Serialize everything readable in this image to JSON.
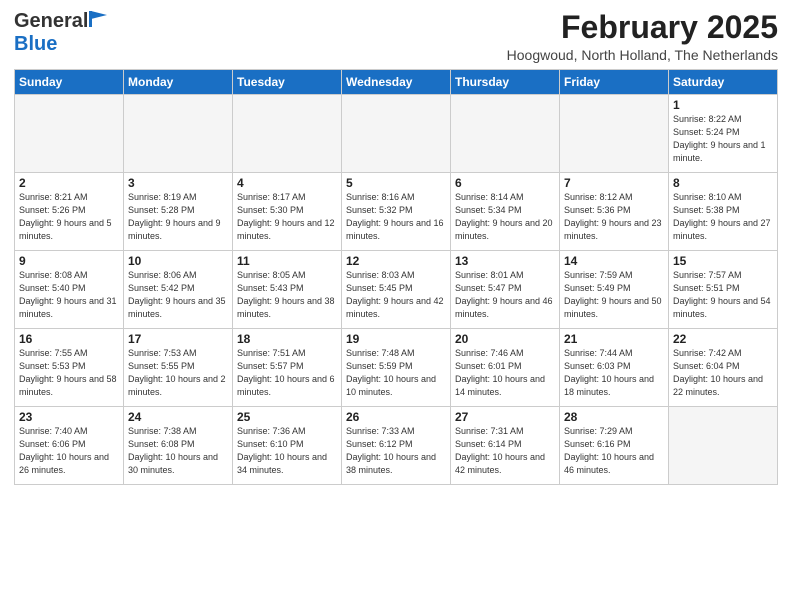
{
  "header": {
    "logo_general": "General",
    "logo_blue": "Blue",
    "title": "February 2025",
    "subtitle": "Hoogwoud, North Holland, The Netherlands"
  },
  "weekdays": [
    "Sunday",
    "Monday",
    "Tuesday",
    "Wednesday",
    "Thursday",
    "Friday",
    "Saturday"
  ],
  "weeks": [
    [
      {
        "day": "",
        "info": ""
      },
      {
        "day": "",
        "info": ""
      },
      {
        "day": "",
        "info": ""
      },
      {
        "day": "",
        "info": ""
      },
      {
        "day": "",
        "info": ""
      },
      {
        "day": "",
        "info": ""
      },
      {
        "day": "1",
        "info": "Sunrise: 8:22 AM\nSunset: 5:24 PM\nDaylight: 9 hours and 1 minute."
      }
    ],
    [
      {
        "day": "2",
        "info": "Sunrise: 8:21 AM\nSunset: 5:26 PM\nDaylight: 9 hours and 5 minutes."
      },
      {
        "day": "3",
        "info": "Sunrise: 8:19 AM\nSunset: 5:28 PM\nDaylight: 9 hours and 9 minutes."
      },
      {
        "day": "4",
        "info": "Sunrise: 8:17 AM\nSunset: 5:30 PM\nDaylight: 9 hours and 12 minutes."
      },
      {
        "day": "5",
        "info": "Sunrise: 8:16 AM\nSunset: 5:32 PM\nDaylight: 9 hours and 16 minutes."
      },
      {
        "day": "6",
        "info": "Sunrise: 8:14 AM\nSunset: 5:34 PM\nDaylight: 9 hours and 20 minutes."
      },
      {
        "day": "7",
        "info": "Sunrise: 8:12 AM\nSunset: 5:36 PM\nDaylight: 9 hours and 23 minutes."
      },
      {
        "day": "8",
        "info": "Sunrise: 8:10 AM\nSunset: 5:38 PM\nDaylight: 9 hours and 27 minutes."
      }
    ],
    [
      {
        "day": "9",
        "info": "Sunrise: 8:08 AM\nSunset: 5:40 PM\nDaylight: 9 hours and 31 minutes."
      },
      {
        "day": "10",
        "info": "Sunrise: 8:06 AM\nSunset: 5:42 PM\nDaylight: 9 hours and 35 minutes."
      },
      {
        "day": "11",
        "info": "Sunrise: 8:05 AM\nSunset: 5:43 PM\nDaylight: 9 hours and 38 minutes."
      },
      {
        "day": "12",
        "info": "Sunrise: 8:03 AM\nSunset: 5:45 PM\nDaylight: 9 hours and 42 minutes."
      },
      {
        "day": "13",
        "info": "Sunrise: 8:01 AM\nSunset: 5:47 PM\nDaylight: 9 hours and 46 minutes."
      },
      {
        "day": "14",
        "info": "Sunrise: 7:59 AM\nSunset: 5:49 PM\nDaylight: 9 hours and 50 minutes."
      },
      {
        "day": "15",
        "info": "Sunrise: 7:57 AM\nSunset: 5:51 PM\nDaylight: 9 hours and 54 minutes."
      }
    ],
    [
      {
        "day": "16",
        "info": "Sunrise: 7:55 AM\nSunset: 5:53 PM\nDaylight: 9 hours and 58 minutes."
      },
      {
        "day": "17",
        "info": "Sunrise: 7:53 AM\nSunset: 5:55 PM\nDaylight: 10 hours and 2 minutes."
      },
      {
        "day": "18",
        "info": "Sunrise: 7:51 AM\nSunset: 5:57 PM\nDaylight: 10 hours and 6 minutes."
      },
      {
        "day": "19",
        "info": "Sunrise: 7:48 AM\nSunset: 5:59 PM\nDaylight: 10 hours and 10 minutes."
      },
      {
        "day": "20",
        "info": "Sunrise: 7:46 AM\nSunset: 6:01 PM\nDaylight: 10 hours and 14 minutes."
      },
      {
        "day": "21",
        "info": "Sunrise: 7:44 AM\nSunset: 6:03 PM\nDaylight: 10 hours and 18 minutes."
      },
      {
        "day": "22",
        "info": "Sunrise: 7:42 AM\nSunset: 6:04 PM\nDaylight: 10 hours and 22 minutes."
      }
    ],
    [
      {
        "day": "23",
        "info": "Sunrise: 7:40 AM\nSunset: 6:06 PM\nDaylight: 10 hours and 26 minutes."
      },
      {
        "day": "24",
        "info": "Sunrise: 7:38 AM\nSunset: 6:08 PM\nDaylight: 10 hours and 30 minutes."
      },
      {
        "day": "25",
        "info": "Sunrise: 7:36 AM\nSunset: 6:10 PM\nDaylight: 10 hours and 34 minutes."
      },
      {
        "day": "26",
        "info": "Sunrise: 7:33 AM\nSunset: 6:12 PM\nDaylight: 10 hours and 38 minutes."
      },
      {
        "day": "27",
        "info": "Sunrise: 7:31 AM\nSunset: 6:14 PM\nDaylight: 10 hours and 42 minutes."
      },
      {
        "day": "28",
        "info": "Sunrise: 7:29 AM\nSunset: 6:16 PM\nDaylight: 10 hours and 46 minutes."
      },
      {
        "day": "",
        "info": ""
      }
    ]
  ]
}
